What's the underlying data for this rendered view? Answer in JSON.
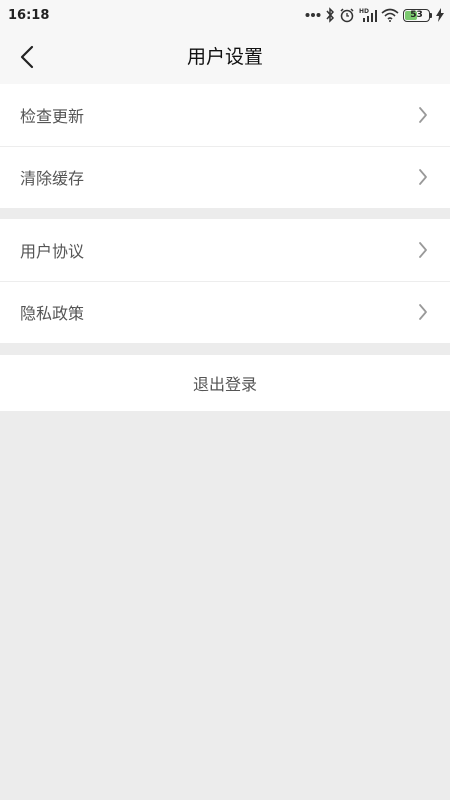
{
  "status_bar": {
    "time": "16:18",
    "battery_level": "53",
    "icons": [
      "more-dots-icon",
      "bluetooth-icon",
      "alarm-icon",
      "signal-hd-icon",
      "wifi-icon",
      "battery-icon",
      "charging-bolt-icon"
    ]
  },
  "navbar": {
    "title": "用户设置",
    "back_icon": "chevron-left-icon"
  },
  "groups": [
    {
      "items": [
        {
          "label": "检查更新"
        },
        {
          "label": "清除缓存"
        }
      ]
    },
    {
      "items": [
        {
          "label": "用户协议"
        },
        {
          "label": "隐私政策"
        }
      ]
    }
  ],
  "logout": {
    "label": "退出登录"
  },
  "colors": {
    "page_background": "#ececec",
    "card_background": "#ffffff",
    "battery_fill": "#7bc96f"
  }
}
